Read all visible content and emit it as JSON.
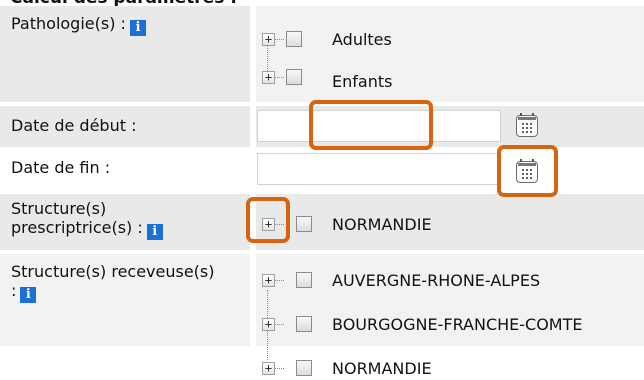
{
  "section": {
    "title": "Calcul des paramètres :"
  },
  "info_icon": {
    "glyph": "i",
    "color": "#1d6fd8"
  },
  "rows": {
    "pathologie": {
      "label": "Pathologie(s) :",
      "items": [
        "Adultes",
        "Enfants"
      ]
    },
    "date_debut": {
      "label": "Date de début :",
      "value": ""
    },
    "date_fin": {
      "label": "Date de fin :",
      "value": ""
    },
    "structure_prescriptrice": {
      "label_line1": "Structure(s)",
      "label_line2": "prescriptrice(s) :",
      "items": [
        "NORMANDIE"
      ]
    },
    "structure_receveuse": {
      "label_line1": "Structure(s) receveuse(s)",
      "label_line2": ":",
      "items": [
        "AUVERGNE-RHONE-ALPES",
        "BOURGOGNE-FRANCHE-COMTE",
        "NORMANDIE"
      ]
    }
  },
  "tree_expander": {
    "glyph": "+"
  },
  "highlight_color": "#d9640f"
}
